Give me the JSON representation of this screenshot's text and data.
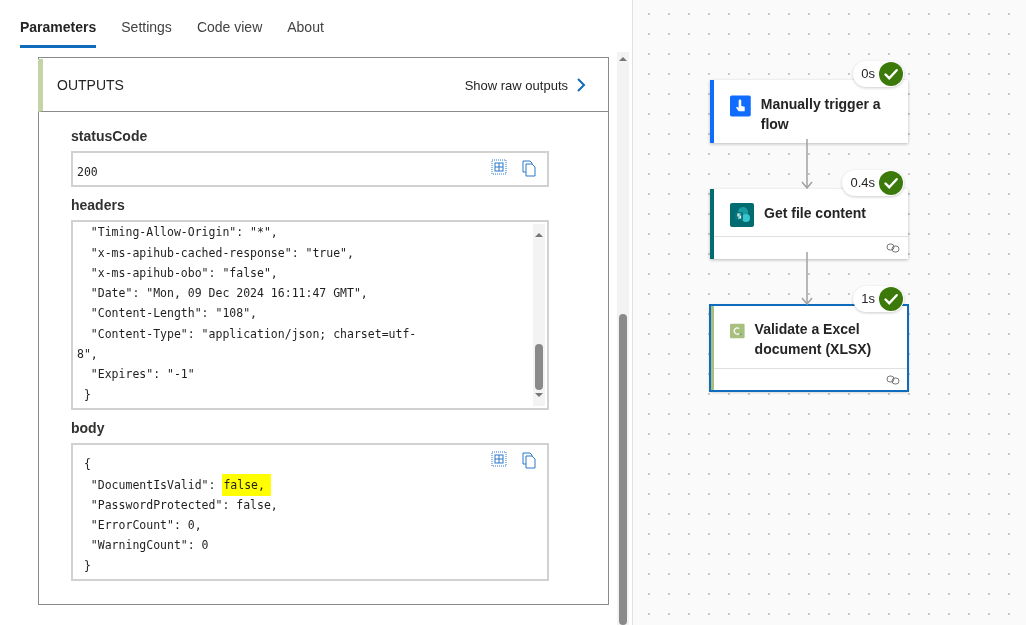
{
  "tabs": [
    {
      "label": "Parameters",
      "selected": true
    },
    {
      "label": "Settings",
      "selected": false
    },
    {
      "label": "Code view",
      "selected": false
    },
    {
      "label": "About",
      "selected": false
    }
  ],
  "outputs": {
    "title": "OUTPUTS",
    "raw_link": "Show raw outputs",
    "fields": [
      {
        "kind": "value",
        "label": "statusCode",
        "lines": [
          {
            "code": "200"
          }
        ]
      },
      {
        "kind": "scroll",
        "label": "headers",
        "lines": [
          {
            "code": "  \"Timing-Allow-Origin\": \"*\","
          },
          {
            "code": "  \"x-ms-apihub-cached-response\": \"true\","
          },
          {
            "code": "  \"x-ms-apihub-obo\": \"false\","
          },
          {
            "code": "  \"Date\": \"Mon, 09 Dec 2024 16:11:47 GMT\","
          },
          {
            "code": "  \"Content-Length\": \"108\","
          },
          {
            "code": "  \"Content-Type\": \"application/json; charset=utf-"
          },
          {
            "code": "8\","
          },
          {
            "code": "  \"Expires\": \"-1\""
          },
          {
            "code": " }"
          }
        ]
      },
      {
        "kind": "value",
        "label": "body",
        "lines": [
          {
            "code": " {"
          },
          {
            "code": "  \"DocumentIsValid\": ",
            "highlight": "false,"
          },
          {
            "code": "  \"PasswordProtected\": false,"
          },
          {
            "code": "  \"ErrorCount\": 0,"
          },
          {
            "code": "  \"WarningCount\": 0"
          },
          {
            "code": " }"
          }
        ]
      }
    ]
  },
  "flow": {
    "nodes": [
      {
        "kind": "trigger",
        "title": "Manually trigger a flow",
        "duration": "0s",
        "succeeded": true,
        "selected": false,
        "footer": false,
        "color": "#0f6cff"
      },
      {
        "kind": "sharepoint",
        "title": "Get file content",
        "duration": "0.4s",
        "succeeded": true,
        "selected": false,
        "footer": true,
        "color": "#036c70"
      },
      {
        "kind": "custom",
        "title": "Validate a Excel document (XLSX)",
        "duration": "1s",
        "succeeded": true,
        "selected": true,
        "footer": true,
        "color": "#a9bf7e"
      }
    ]
  }
}
